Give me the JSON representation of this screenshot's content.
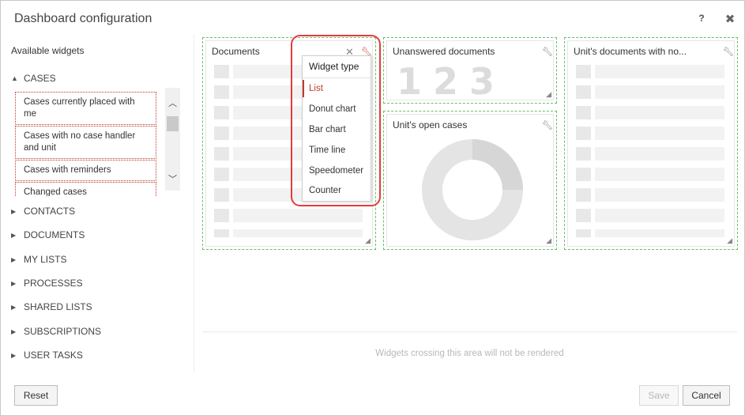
{
  "dialog": {
    "title": "Dashboard configuration",
    "help_label": "?",
    "close_label": "✖"
  },
  "left_panel": {
    "title": "Available widgets",
    "expanded_category": "CASES",
    "case_widgets": [
      "Cases currently placed with me",
      "Cases with no case handler and unit",
      "Cases with reminders",
      "Changed cases"
    ],
    "categories": [
      "CONTACTS",
      "DOCUMENTS",
      "MY LISTS",
      "PROCESSES",
      "SHARED LISTS",
      "SUBSCRIPTIONS",
      "USER TASKS"
    ]
  },
  "widgets": {
    "documents": {
      "title": "Documents"
    },
    "unanswered": {
      "title": "Unanswered documents",
      "counter_text": "123"
    },
    "unit_documents": {
      "title": "Unit's documents with no..."
    },
    "unit_open_cases": {
      "title": "Unit's open cases"
    }
  },
  "widget_type_menu": {
    "header": "Widget type",
    "selected": "List",
    "items": [
      "List",
      "Donut chart",
      "Bar chart",
      "Time line",
      "Speedometer",
      "Counter"
    ]
  },
  "canvas": {
    "no_render_text": "Widgets crossing this area will not be rendered"
  },
  "footer": {
    "reset_label": "Reset",
    "save_label": "Save",
    "cancel_label": "Cancel"
  },
  "colors": {
    "accent_red": "#c0392b",
    "highlight_ring": "#e53b3b",
    "widget_border": "#6abf69"
  },
  "icons": {
    "wrench": "wrench-icon",
    "close": "close-icon",
    "resize": "resize-handle-icon",
    "expand": "triangle-right-icon",
    "collapse": "triangle-down-icon"
  }
}
